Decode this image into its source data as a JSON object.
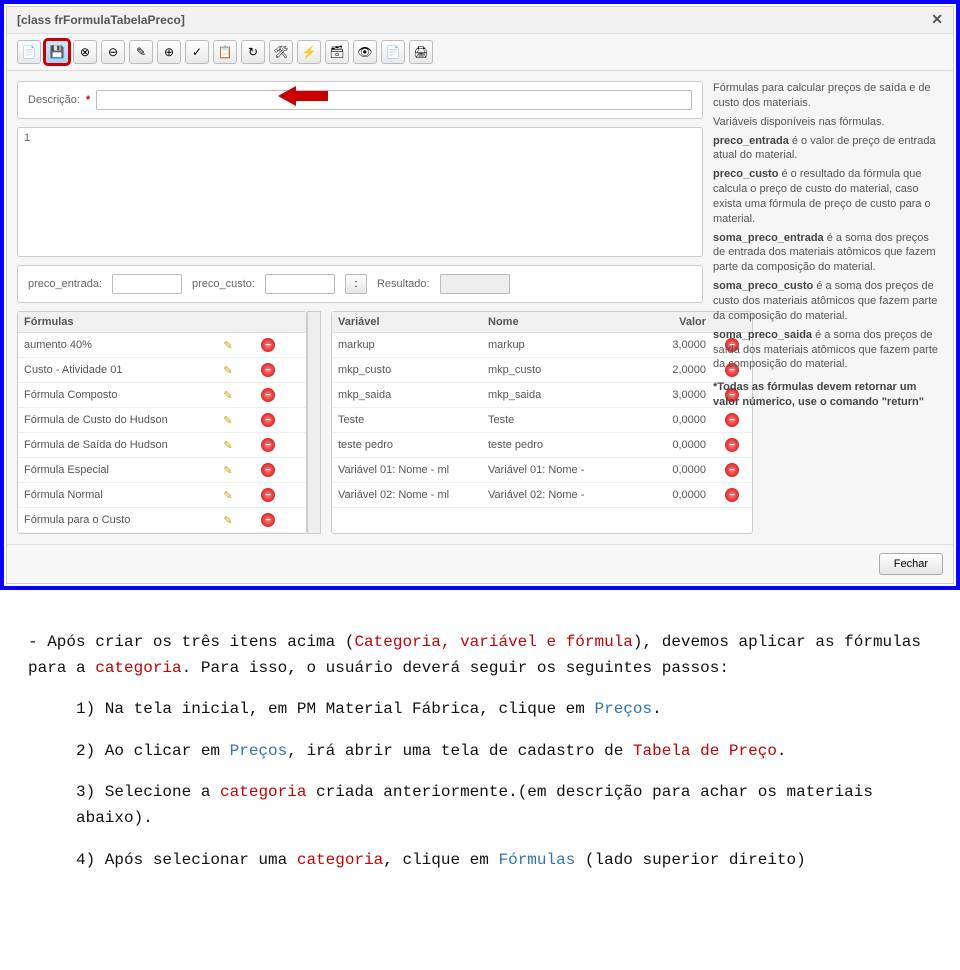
{
  "window": {
    "title": "[class frFormulaTabelaPreco]",
    "close_label": "✕",
    "footer_close": "Fechar"
  },
  "toolbar_icons": [
    "📄",
    "💾",
    "⊗",
    "⊖",
    "✎",
    "⊕",
    "✓",
    "📋",
    "↻",
    "🛠",
    "⚡",
    "🗃",
    "👁",
    "📄",
    "🖨"
  ],
  "desc": {
    "label": "Descrição:",
    "asterisk": "*"
  },
  "editor": {
    "line_no": "1"
  },
  "calc": {
    "preco_entrada_label": "preco_entrada:",
    "preco_custo_label": "preco_custo:",
    "colon_btn": ":",
    "resultado_label": "Resultado:"
  },
  "formulas": {
    "header": "Fórmulas",
    "rows": [
      {
        "name": "aumento 40%"
      },
      {
        "name": "Custo - Atividade 01"
      },
      {
        "name": "Fórmula Composto"
      },
      {
        "name": "Fórmula de Custo do Hudson"
      },
      {
        "name": "Fórmula de Saída do Hudson"
      },
      {
        "name": "Fórmula Especial"
      },
      {
        "name": "Fórmula Normal"
      },
      {
        "name": "Fórmula para o Custo"
      }
    ]
  },
  "vars": {
    "header_var": "Variável",
    "header_nome": "Nome",
    "header_valor": "Valor",
    "rows": [
      {
        "var": "markup",
        "nome": "markup",
        "valor": "3,0000"
      },
      {
        "var": "mkp_custo",
        "nome": "mkp_custo",
        "valor": "2,0000"
      },
      {
        "var": "mkp_saida",
        "nome": "mkp_saida",
        "valor": "3,0000"
      },
      {
        "var": "Teste",
        "nome": "Teste",
        "valor": "0,0000"
      },
      {
        "var": "teste pedro",
        "nome": "teste pedro",
        "valor": "0,0000"
      },
      {
        "var": "Variável 01: Nome - ml",
        "nome": "Variável 01: Nome -",
        "valor": "0,0000"
      },
      {
        "var": "Variável 02: Nome - ml",
        "nome": "Variável 02: Nome -",
        "valor": "0,0000"
      }
    ]
  },
  "help": {
    "p1": "Fórmulas para calcular preços de saída e de custo dos materiais.",
    "p2": "Variáveis disponíveis nas fórmulas.",
    "p3a": "preco_entrada",
    "p3b": " é o valor de preço de entrada atual do material.",
    "p4a": "preco_custo",
    "p4b": " é o resultado da fórmula que calcula o preço de custo do material, caso exista uma fórmula de preço de custo para o material.",
    "p5a": "soma_preco_entrada",
    "p5b": " é a soma dos preços de entrada dos materiais atômicos que fazem parte da composição do material.",
    "p6a": "soma_preco_custo",
    "p6b": " é a soma dos preços de custo dos materiais atômicos que fazem parte da composição do material.",
    "p7a": "soma_preco_saida",
    "p7b": " é a soma dos preços de saída dos materiais atômicos que fazem parte da composição do material.",
    "p8": "*Todas as fórmulas devem retornar um valor númerico, use o comando \"return\""
  },
  "instr": {
    "line0a": "- Após criar os três itens acima (",
    "line0b": "Categoria, variável e fórmula",
    "line0c": "), devemos aplicar as fórmulas para a ",
    "line0d": "categoria",
    "line0e": ". Para isso, o usuário deverá seguir os seguintes passos:",
    "step1a": "1) Na tela inicial, em PM Material Fábrica, clique em ",
    "step1b": "Preços",
    "step1c": ".",
    "step2a": "2) Ao clicar em ",
    "step2b": "Preços",
    "step2c": ", irá abrir uma tela de cadastro de ",
    "step2d": "Tabela de Preço",
    "step2e": ".",
    "step3a": "3) Selecione a ",
    "step3b": "categoria",
    "step3c": " criada anteriormente.(em descrição para achar os materiais abaixo).",
    "step4a": "4) Após selecionar uma ",
    "step4b": "categoria",
    "step4c": ", clique em ",
    "step4d": "Fórmulas",
    "step4e": " (lado superior direito)"
  }
}
